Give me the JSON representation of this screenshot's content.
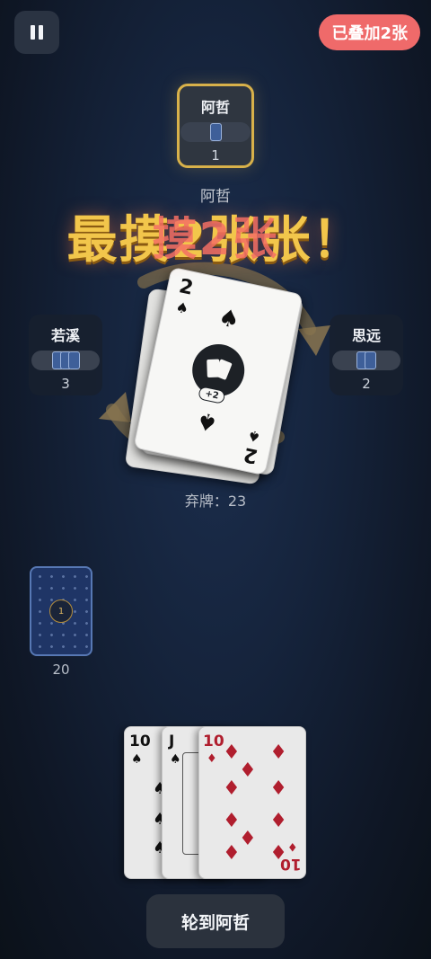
{
  "top_bar": {
    "pause_icon": "pause-icon",
    "stack_badge": "已叠加2张"
  },
  "players": {
    "top": {
      "name": "阿哲",
      "count": "1"
    },
    "left": {
      "name": "若溪",
      "count": "3"
    },
    "right": {
      "name": "思远",
      "count": "2"
    }
  },
  "turn_name": "阿哲",
  "announce": {
    "text": "最摸2张张！",
    "ghost": "摸2张"
  },
  "discard": {
    "label": "弃牌：23",
    "top_card": {
      "rank": "2",
      "suit": "spade",
      "action": "+2"
    },
    "under_card": {
      "rank": "A",
      "suit": "spade"
    }
  },
  "deck": {
    "count": "20",
    "center_mark": "1"
  },
  "hand": [
    {
      "rank": "10",
      "suit": "spade",
      "color": "#111111"
    },
    {
      "rank": "J",
      "suit": "spade",
      "color": "#111111"
    },
    {
      "rank": "10",
      "suit": "diamond",
      "color": "#b01e2e"
    }
  ],
  "turn_button": "轮到阿哲",
  "colors": {
    "accent_gold": "#d8b14a",
    "badge_red": "#ef6a6a",
    "card_red": "#b01e2e",
    "deck_blue": "#1f3566"
  }
}
